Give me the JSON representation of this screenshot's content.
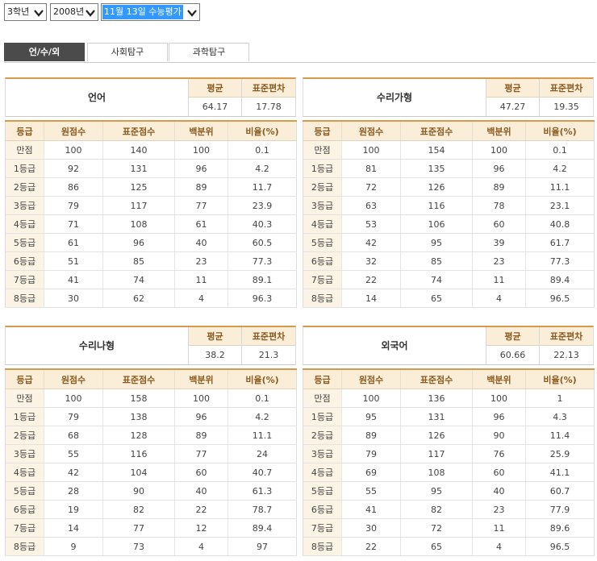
{
  "filters": {
    "grade": "3학년",
    "year": "2008년",
    "exam": "11월 13일 수능평가"
  },
  "tabs": [
    "언/수/외",
    "사회탐구",
    "과학탐구"
  ],
  "labels": {
    "avg": "평균",
    "sd": "표준편차"
  },
  "columns": [
    "등급",
    "원점수",
    "표준점수",
    "백분위",
    "비율(%)"
  ],
  "panels": [
    {
      "subject": "언어",
      "avg": "64.17",
      "sd": "17.78",
      "rows": [
        [
          "만점",
          "100",
          "140",
          "100",
          "0.1"
        ],
        [
          "1등급",
          "92",
          "131",
          "96",
          "4.2"
        ],
        [
          "2등급",
          "86",
          "125",
          "89",
          "11.7"
        ],
        [
          "3등급",
          "79",
          "117",
          "77",
          "23.9"
        ],
        [
          "4등급",
          "71",
          "108",
          "61",
          "40.3"
        ],
        [
          "5등급",
          "61",
          "96",
          "40",
          "60.5"
        ],
        [
          "6등급",
          "51",
          "85",
          "23",
          "77.3"
        ],
        [
          "7등급",
          "41",
          "74",
          "11",
          "89.1"
        ],
        [
          "8등급",
          "30",
          "62",
          "4",
          "96.3"
        ]
      ]
    },
    {
      "subject": "수리가형",
      "avg": "47.27",
      "sd": "19.35",
      "rows": [
        [
          "만점",
          "100",
          "154",
          "100",
          "0.1"
        ],
        [
          "1등급",
          "81",
          "135",
          "96",
          "4.2"
        ],
        [
          "2등급",
          "72",
          "126",
          "89",
          "11.1"
        ],
        [
          "3등급",
          "63",
          "116",
          "78",
          "23.1"
        ],
        [
          "4등급",
          "53",
          "106",
          "60",
          "40.8"
        ],
        [
          "5등급",
          "42",
          "95",
          "39",
          "61.7"
        ],
        [
          "6등급",
          "32",
          "85",
          "23",
          "77.3"
        ],
        [
          "7등급",
          "22",
          "74",
          "11",
          "89.4"
        ],
        [
          "8등급",
          "14",
          "65",
          "4",
          "96.5"
        ]
      ]
    },
    {
      "subject": "수리나형",
      "avg": "38.2",
      "sd": "21.3",
      "rows": [
        [
          "만점",
          "100",
          "158",
          "100",
          "0.1"
        ],
        [
          "1등급",
          "79",
          "138",
          "96",
          "4.2"
        ],
        [
          "2등급",
          "68",
          "128",
          "89",
          "11.1"
        ],
        [
          "3등급",
          "55",
          "116",
          "77",
          "24"
        ],
        [
          "4등급",
          "42",
          "104",
          "60",
          "40.7"
        ],
        [
          "5등급",
          "28",
          "90",
          "40",
          "61.3"
        ],
        [
          "6등급",
          "19",
          "82",
          "22",
          "78.7"
        ],
        [
          "7등급",
          "14",
          "77",
          "12",
          "89.4"
        ],
        [
          "8등급",
          "9",
          "73",
          "4",
          "97"
        ]
      ]
    },
    {
      "subject": "외국어",
      "avg": "60.66",
      "sd": "22.13",
      "rows": [
        [
          "만점",
          "100",
          "136",
          "100",
          "1"
        ],
        [
          "1등급",
          "95",
          "131",
          "96",
          "4.3"
        ],
        [
          "2등급",
          "89",
          "126",
          "90",
          "11.4"
        ],
        [
          "3등급",
          "79",
          "117",
          "76",
          "25.9"
        ],
        [
          "4등급",
          "69",
          "108",
          "60",
          "41.1"
        ],
        [
          "5등급",
          "55",
          "95",
          "40",
          "60.7"
        ],
        [
          "6등급",
          "41",
          "82",
          "23",
          "77.9"
        ],
        [
          "7등급",
          "30",
          "72",
          "11",
          "89.6"
        ],
        [
          "8등급",
          "22",
          "65",
          "4",
          "96.5"
        ]
      ]
    }
  ]
}
